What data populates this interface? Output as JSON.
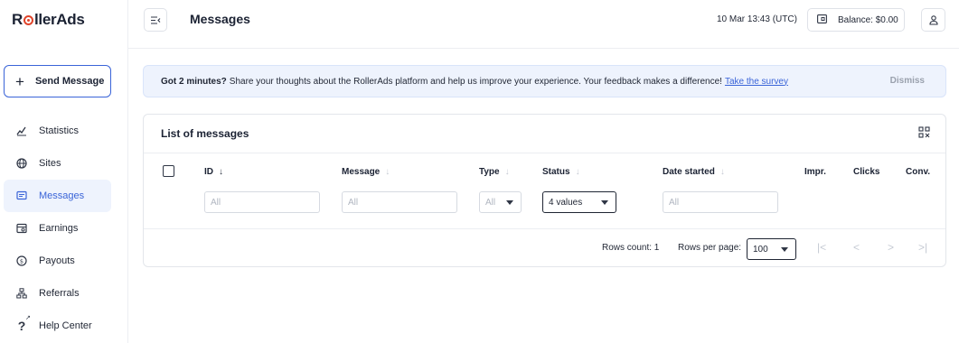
{
  "app": {
    "logo_text_pre": "R",
    "logo_text_post": "llerAds"
  },
  "sidebar": {
    "send_button_label": "Send Message",
    "items": [
      {
        "label": "Statistics",
        "icon": "chart-icon",
        "active": false
      },
      {
        "label": "Sites",
        "icon": "globe-icon",
        "active": false
      },
      {
        "label": "Messages",
        "icon": "message-icon",
        "active": true
      },
      {
        "label": "Earnings",
        "icon": "earnings-icon",
        "active": false
      },
      {
        "label": "Payouts",
        "icon": "dollar-icon",
        "active": false
      },
      {
        "label": "Referrals",
        "icon": "referrals-icon",
        "active": false
      },
      {
        "label": "Help Center",
        "icon": "help-icon",
        "active": false
      }
    ]
  },
  "header": {
    "title": "Messages",
    "datetime": "10 Mar 13:43 (UTC)",
    "balance": "Balance: $0.00"
  },
  "banner": {
    "bold": "Got 2 minutes?",
    "text": "Share your thoughts about the RollerAds platform and help us improve your experience. Your feedback makes a difference!",
    "link": "Take the survey",
    "dismiss": "Dismiss"
  },
  "table": {
    "title": "List of messages",
    "columns": {
      "id": "ID",
      "message": "Message",
      "type": "Type",
      "status": "Status",
      "date_started": "Date started",
      "impr": "Impr.",
      "clicks": "Clicks",
      "conv": "Conv."
    },
    "filters": {
      "id_placeholder": "All",
      "message_placeholder": "All",
      "type_value": "All",
      "status_value": "4 values",
      "date_placeholder": "All"
    },
    "footer": {
      "rows_count": "Rows count: 1",
      "rows_per_page_label": "Rows per page:",
      "rows_per_page_value": "100"
    }
  },
  "colors": {
    "accent": "#3a64d8",
    "logo_accent": "#e0442a",
    "banner_bg": "#eef3fd"
  }
}
